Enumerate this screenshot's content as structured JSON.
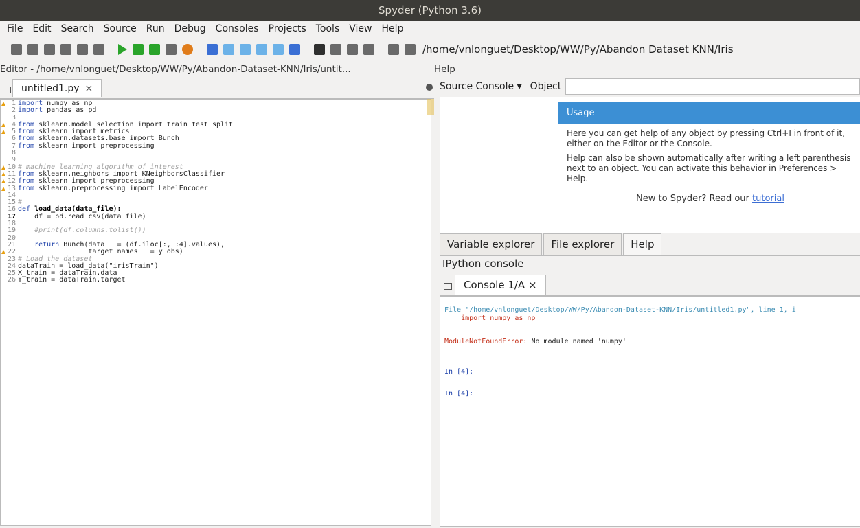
{
  "window": {
    "title": "Spyder (Python 3.6)"
  },
  "menu": [
    "File",
    "Edit",
    "Search",
    "Source",
    "Run",
    "Debug",
    "Consoles",
    "Projects",
    "Tools",
    "View",
    "Help"
  ],
  "toolbar": {
    "path": "/home/vnlonguet/Desktop/WW/Py/Abandon Dataset KNN/Iris"
  },
  "editor": {
    "title": "Editor - /home/vnlonguet/Desktop/WW/Py/Abandon-Dataset-KNN/Iris/untit...",
    "tab": "untitled1.py",
    "tab_close": "×",
    "lines": [
      {
        "n": "1",
        "warn": true,
        "kw": "import",
        "rest": " numpy as np"
      },
      {
        "n": "2",
        "warn": false,
        "kw": "import",
        "rest": " pandas as pd"
      },
      {
        "n": "3",
        "warn": false,
        "kw": "",
        "rest": ""
      },
      {
        "n": "4",
        "warn": true,
        "kw": "from",
        "rest": " sklearn.model_selection import train_test_split"
      },
      {
        "n": "5",
        "warn": true,
        "kw": "from",
        "rest": " sklearn import metrics"
      },
      {
        "n": "6",
        "warn": false,
        "kw": "from",
        "rest": " sklearn.datasets.base import Bunch"
      },
      {
        "n": "7",
        "warn": false,
        "kw": "from",
        "rest": " sklearn import preprocessing"
      },
      {
        "n": "8",
        "warn": false,
        "kw": "",
        "rest": ""
      },
      {
        "n": "9",
        "warn": false,
        "kw": "",
        "rest": ""
      },
      {
        "n": "10",
        "warn": true,
        "kw": "",
        "rest": "# machine learning algorithm of interest",
        "cm": true
      },
      {
        "n": "11",
        "warn": true,
        "kw": "from",
        "rest": " sklearn.neighbors import KNeighborsClassifier"
      },
      {
        "n": "12",
        "warn": true,
        "kw": "from",
        "rest": " sklearn import preprocessing"
      },
      {
        "n": "13",
        "warn": true,
        "kw": "from",
        "rest": " sklearn.preprocessing import LabelEncoder"
      },
      {
        "n": "14",
        "warn": false,
        "kw": "",
        "rest": ""
      },
      {
        "n": "15",
        "warn": false,
        "kw": "",
        "rest": "#",
        "cm": true
      },
      {
        "n": "16",
        "warn": false,
        "kw": "def",
        "rest": " load_data(data_file):",
        "fn": true
      },
      {
        "n": "17",
        "warn": false,
        "kw": "",
        "rest": "    df = pd.read_csv(data_file)",
        "cur": true
      },
      {
        "n": "18",
        "warn": false,
        "kw": "",
        "rest": ""
      },
      {
        "n": "19",
        "warn": false,
        "kw": "",
        "rest": "    #print(df.columns.tolist())",
        "cm": true
      },
      {
        "n": "20",
        "warn": false,
        "kw": "",
        "rest": ""
      },
      {
        "n": "21",
        "warn": false,
        "kw": "    return",
        "rest": " Bunch(data   = (df.iloc[:, :4].values),"
      },
      {
        "n": "22",
        "warn": true,
        "kw": "",
        "rest": "                 target_names   = y_obs)"
      },
      {
        "n": "23",
        "warn": false,
        "kw": "",
        "rest": "# Load the dataset",
        "cm": true
      },
      {
        "n": "24",
        "warn": false,
        "kw": "",
        "rest": "dataTrain = load_data(\"irisTrain\")"
      },
      {
        "n": "25",
        "warn": false,
        "kw": "",
        "rest": "X_train = dataTrain.data"
      },
      {
        "n": "26",
        "warn": false,
        "kw": "",
        "rest": "Y_train = dataTrain.target"
      }
    ]
  },
  "help": {
    "title": "Help",
    "source_label": "Source Console",
    "source_arrow": "▾",
    "object_label": "Object",
    "usage_title": "Usage",
    "usage_p1": "Here you can get help of any object by pressing Ctrl+I in front of it, either on the Editor or the Console.",
    "usage_p2": "Help can also be shown automatically after writing a left parenthesis next to an object. You can activate this behavior in Preferences > Help.",
    "usage_new": "New to Spyder? Read our",
    "usage_link": "tutorial"
  },
  "panel_tabs": [
    "Variable explorer",
    "File explorer",
    "Help"
  ],
  "ipython": {
    "title": "IPython console",
    "tab": "Console 1/A",
    "tab_close": "×",
    "lines": [
      "File \"/home/vnlonguet/Desktop/WW/Py/Abandon-Dataset-KNN/Iris/untitled1.py\", line 1, i",
      "    import numpy as np",
      "ModuleNotFoundError: No module named 'numpy'",
      "In [4]:",
      "In [4]:"
    ]
  },
  "colors": {
    "accent": "#3c8fd4",
    "title_bar": "#3c3b37",
    "run_green": "#2aa42a",
    "error_red": "#c4301a"
  }
}
